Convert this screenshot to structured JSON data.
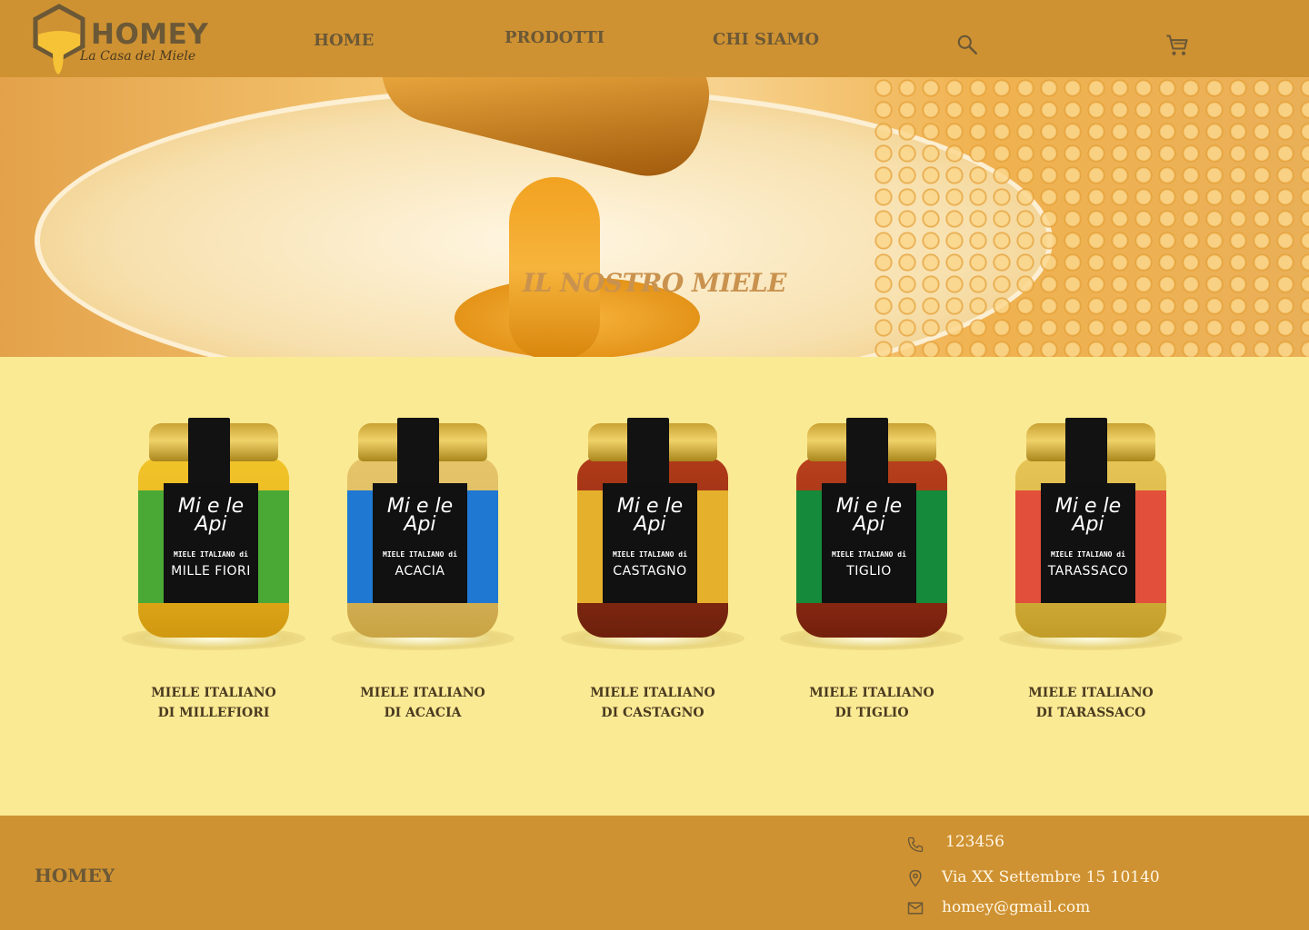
{
  "brand": {
    "name": "HOMEY",
    "tagline": "La Casa del Miele"
  },
  "nav": {
    "items": [
      {
        "label": "HOME"
      },
      {
        "label": "PRODOTTI"
      },
      {
        "label": "CHI SIAMO"
      }
    ],
    "icons": [
      "search-icon",
      "cart-icon"
    ]
  },
  "hero": {
    "title": "IL NOSTRO MIELE"
  },
  "products": [
    {
      "title_line1": "MIELE ITALIANO",
      "title_line2": "DI MILLEFIORI",
      "jar_brand": "Mi e le Api",
      "jar_sub": "MIELE ITALIANO di",
      "jar_name": "MILLE FIORI",
      "label_color": "#4aa935",
      "honey_color": "#e8b01a"
    },
    {
      "title_line1": "MIELE ITALIANO",
      "title_line2": "DI ACACIA",
      "jar_brand": "Mi e le Api",
      "jar_sub": "MIELE ITALIANO di",
      "jar_name": "ACACIA",
      "label_color": "#1f78d1",
      "honey_color": "#d9b760"
    },
    {
      "title_line1": "MIELE ITALIANO",
      "title_line2": "DI CASTAGNO",
      "jar_brand": "Mi e le Api",
      "jar_sub": "MIELE ITALIANO di",
      "jar_name": "CASTAGNO",
      "label_color": "#e5b02c",
      "honey_color": "#8c2d14"
    },
    {
      "title_line1": "MIELE ITALIANO",
      "title_line2": "DI TIGLIO",
      "jar_brand": "Mi e le Api",
      "jar_sub": "MIELE ITALIANO di",
      "jar_name": "TIGLIO",
      "label_color": "#148a3a",
      "honey_color": "#9a2e16"
    },
    {
      "title_line1": "MIELE ITALIANO",
      "title_line2": "DI TARASSACO",
      "jar_brand": "Mi e le Api",
      "jar_sub": "MIELE ITALIANO di",
      "jar_name": "TARASSACO",
      "label_color": "#e2503c",
      "honey_color": "#d8b540"
    }
  ],
  "footer": {
    "brand": "HOMEY",
    "phone": "123456",
    "address": "Via XX Settembre 15 10140",
    "email": "homey@gmail.com"
  },
  "colors": {
    "header_bg": "#cf9232",
    "page_bg": "#fbea94",
    "nav_text": "#6b5836"
  }
}
